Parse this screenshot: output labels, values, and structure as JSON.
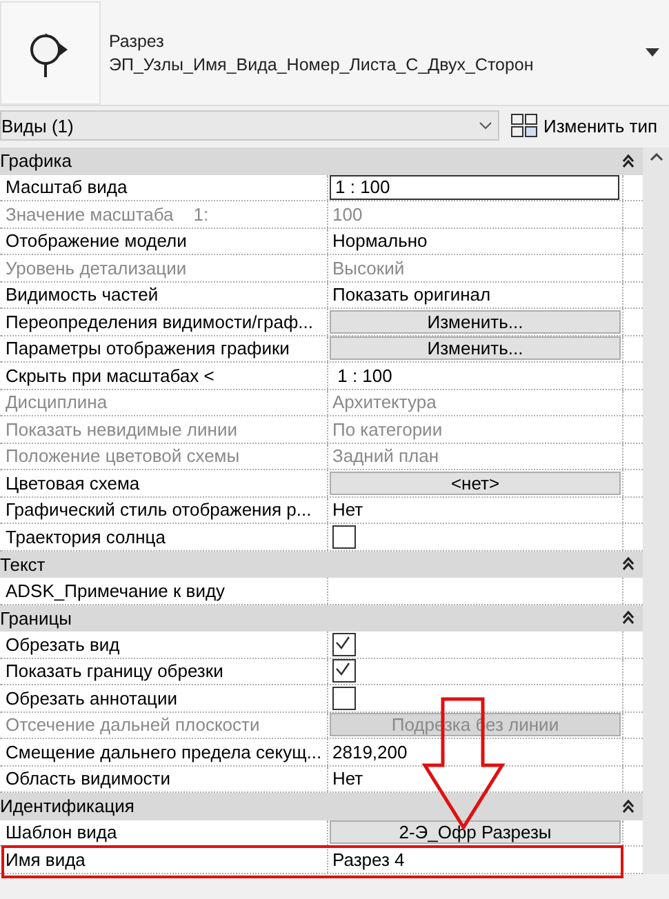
{
  "header": {
    "family": "Разрез",
    "type_name": "ЭП_Узлы_Имя_Вида_Номер_Листа_С_Двух_Сторон"
  },
  "filter": {
    "value": "Виды (1)",
    "edit_type_button": "Изменить тип"
  },
  "groups": [
    {
      "title": "Графика",
      "expanded": true,
      "rows": [
        {
          "label": "Масштаб вида",
          "kind": "field",
          "value": "1 : 100",
          "disabled": false
        },
        {
          "label": "Значение масштаба    1:",
          "kind": "text",
          "value": "100",
          "disabled": true
        },
        {
          "label": "Отображение модели",
          "kind": "text",
          "value": "Нормально",
          "disabled": false
        },
        {
          "label": "Уровень детализации",
          "kind": "text",
          "value": "Высокий",
          "disabled": true
        },
        {
          "label": "Видимость частей",
          "kind": "text",
          "value": "Показать оригинал",
          "disabled": false
        },
        {
          "label": "Переопределения видимости/граф...",
          "kind": "button",
          "value": "Изменить...",
          "disabled": false
        },
        {
          "label": "Параметры отображения графики",
          "kind": "button",
          "value": "Изменить...",
          "disabled": false
        },
        {
          "label": "Скрыть при масштабах <",
          "kind": "text",
          "value": " 1 : 100",
          "disabled": false
        },
        {
          "label": "Дисциплина",
          "kind": "text",
          "value": "Архитектура",
          "disabled": true
        },
        {
          "label": "Показать невидимые линии",
          "kind": "text",
          "value": "По категории",
          "disabled": true
        },
        {
          "label": "Положение цветовой схемы",
          "kind": "text",
          "value": "Задний план",
          "disabled": true
        },
        {
          "label": "Цветовая схема",
          "kind": "button",
          "value": "<нет>",
          "disabled": false
        },
        {
          "label": "Графический стиль отображения р...",
          "kind": "text",
          "value": "Нет",
          "disabled": false
        },
        {
          "label": "Траектория солнца",
          "kind": "checkbox",
          "checked": false,
          "disabled": false
        }
      ]
    },
    {
      "title": "Текст",
      "expanded": true,
      "rows": [
        {
          "label": "ADSK_Примечание к виду",
          "kind": "empty",
          "disabled": false
        }
      ]
    },
    {
      "title": "Границы",
      "expanded": true,
      "rows": [
        {
          "label": "Обрезать вид",
          "kind": "checkbox",
          "checked": true,
          "disabled": false
        },
        {
          "label": "Показать границу обрезки",
          "kind": "checkbox",
          "checked": true,
          "disabled": false
        },
        {
          "label": "Обрезать аннотации",
          "kind": "checkbox",
          "checked": false,
          "disabled": false
        },
        {
          "label": "Отсечение дальней плоскости",
          "kind": "button",
          "value": "Подрезка без линии",
          "disabled": true
        },
        {
          "label": "Смещение дальнего предела секущ...",
          "kind": "text",
          "value": "2819,200",
          "disabled": false
        },
        {
          "label": "Область видимости",
          "kind": "text",
          "value": "Нет",
          "disabled": false
        }
      ]
    },
    {
      "title": "Идентификация",
      "expanded": true,
      "rows": [
        {
          "label": "Шаблон вида",
          "kind": "button",
          "value": "2-Э_Офр Разрезы",
          "disabled": false
        },
        {
          "label": "Имя вида",
          "kind": "text",
          "value": "Разрез 4",
          "disabled": false,
          "highlighted": true
        }
      ]
    }
  ]
}
